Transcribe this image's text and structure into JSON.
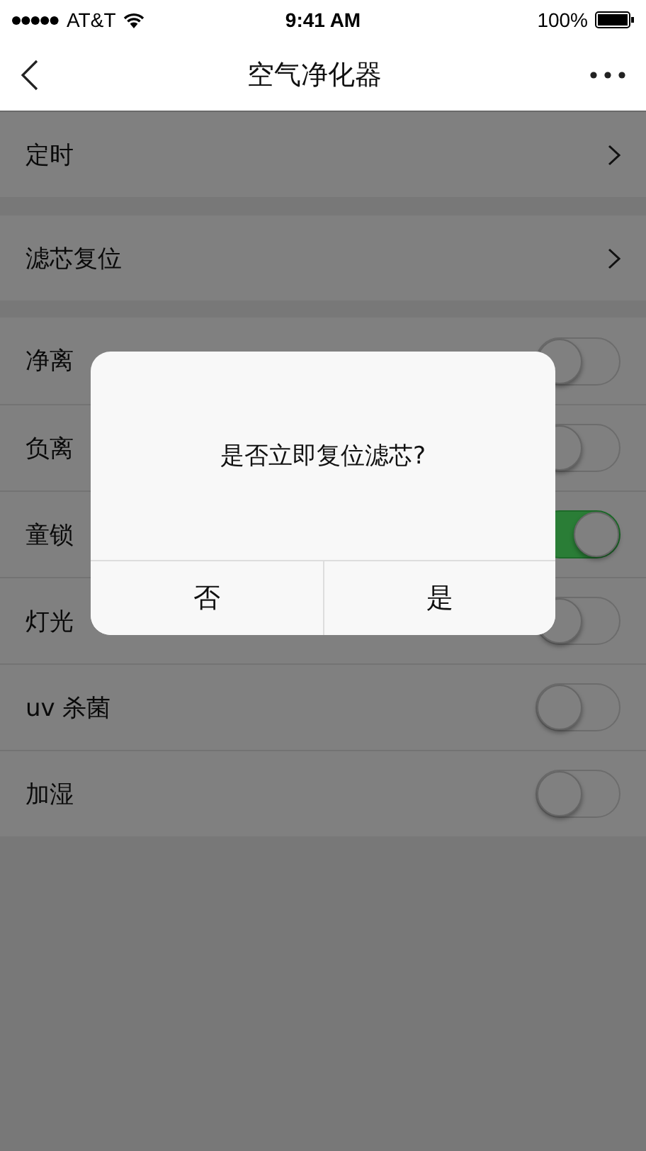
{
  "status_bar": {
    "carrier": "AT&T",
    "time": "9:41 AM",
    "battery": "100%"
  },
  "nav": {
    "title": "空气净化器"
  },
  "menu_rows": [
    {
      "label": "定时"
    },
    {
      "label": "滤芯复位"
    }
  ],
  "toggle_rows": [
    {
      "label": "净离",
      "on": false
    },
    {
      "label": "负离",
      "on": false
    },
    {
      "label": "童锁",
      "on": true
    },
    {
      "label": "灯光",
      "on": false
    },
    {
      "label": "uv 杀菌",
      "on": false
    },
    {
      "label": "加湿",
      "on": false
    }
  ],
  "dialog": {
    "message": "是否立即复位滤芯?",
    "buttons": [
      "否",
      "是"
    ]
  }
}
